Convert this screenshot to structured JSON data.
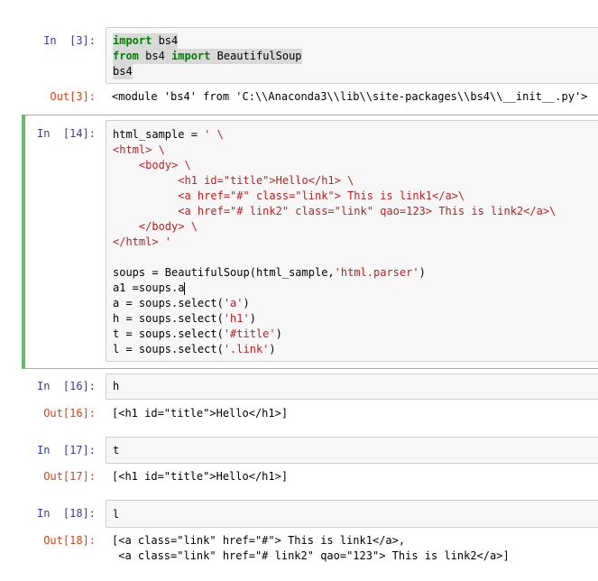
{
  "cells": [
    {
      "in_prompt": "In  [3]:",
      "code_lines": [
        [
          {
            "t": "import",
            "c": "kw"
          },
          {
            "t": " bs4",
            "c": ""
          }
        ],
        [
          {
            "t": "from",
            "c": "kw"
          },
          {
            "t": " bs4 ",
            "c": ""
          },
          {
            "t": "import",
            "c": "kw"
          },
          {
            "t": " BeautifulSoup",
            "c": ""
          }
        ],
        [
          {
            "t": "bs4",
            "c": ""
          }
        ]
      ],
      "out_prompt": "Out[3]:",
      "output_lines": [
        "<module 'bs4' from 'C:\\\\Anaconda3\\\\lib\\\\site-packages\\\\bs4\\\\__init__.py'>"
      ]
    },
    {
      "in_prompt": "In  [14]:",
      "code_lines": [
        [
          {
            "t": "html_sample = ",
            "c": ""
          },
          {
            "t": "' \\",
            "c": "str"
          }
        ],
        [
          {
            "t": "<html> \\",
            "c": "str"
          }
        ],
        [
          {
            "t": "    <body> \\",
            "c": "str"
          }
        ],
        [
          {
            "t": "          <h1 id=\"title\">Hello</h1> \\",
            "c": "str"
          }
        ],
        [
          {
            "t": "          <a href=\"#\" class=\"link\"> This is link1</a>\\",
            "c": "str"
          }
        ],
        [
          {
            "t": "          <a href=\"# link2\" class=\"link\" qao=123> This is link2</a>\\",
            "c": "str"
          }
        ],
        [
          {
            "t": "    </body> \\",
            "c": "str"
          }
        ],
        [
          {
            "t": "</html> '",
            "c": "str"
          }
        ],
        [
          {
            "t": "",
            "c": ""
          }
        ],
        [
          {
            "t": "soups = BeautifulSoup(html_sample,",
            "c": ""
          },
          {
            "t": "'html.parser'",
            "c": "str"
          },
          {
            "t": ")",
            "c": ""
          }
        ],
        [
          {
            "t": "a1 =soups.a",
            "c": ""
          }
        ],
        [
          {
            "t": "a = soups.select(",
            "c": ""
          },
          {
            "t": "'a'",
            "c": "str"
          },
          {
            "t": ")",
            "c": ""
          }
        ],
        [
          {
            "t": "h = soups.select(",
            "c": ""
          },
          {
            "t": "'h1'",
            "c": "str"
          },
          {
            "t": ")",
            "c": ""
          }
        ],
        [
          {
            "t": "t = soups.select(",
            "c": ""
          },
          {
            "t": "'#title'",
            "c": "str"
          },
          {
            "t": ")",
            "c": ""
          }
        ],
        [
          {
            "t": "l = soups.select(",
            "c": ""
          },
          {
            "t": "'.link'",
            "c": "str"
          },
          {
            "t": ")",
            "c": ""
          }
        ]
      ]
    },
    {
      "in_prompt": "In  [16]:",
      "code_lines": [
        [
          {
            "t": "h",
            "c": ""
          }
        ]
      ],
      "out_prompt": "Out[16]:",
      "output_lines": [
        "[<h1 id=\"title\">Hello</h1>]"
      ]
    },
    {
      "in_prompt": "In  [17]:",
      "code_lines": [
        [
          {
            "t": "t",
            "c": ""
          }
        ]
      ],
      "out_prompt": "Out[17]:",
      "output_lines": [
        "[<h1 id=\"title\">Hello</h1>]"
      ]
    },
    {
      "in_prompt": "In  [18]:",
      "code_lines": [
        [
          {
            "t": "l",
            "c": ""
          }
        ]
      ],
      "out_prompt": "Out[18]:",
      "output_lines": [
        "[<a class=\"link\" href=\"#\"> This is link1</a>,",
        " <a class=\"link\" href=\"# link2\" qao=\"123\"> This is link2</a>]"
      ]
    }
  ]
}
